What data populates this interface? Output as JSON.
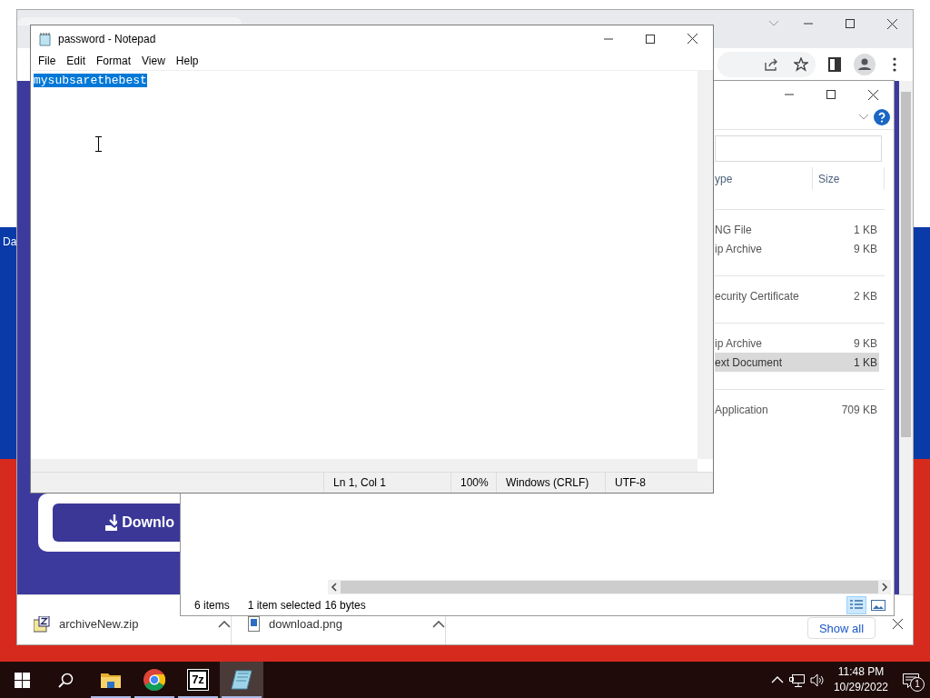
{
  "desktop": {
    "icon_label": "Da"
  },
  "browser": {
    "page": {
      "download_button": "Downlo"
    },
    "downloads": [
      {
        "name": "archiveNew.zip",
        "kind": "archive"
      },
      {
        "name": "download.png",
        "kind": "image"
      }
    ],
    "show_all": "Show all"
  },
  "explorer": {
    "columns": [
      "ype",
      "Size"
    ],
    "groups": [
      {
        "rows": [
          {
            "type": "NG File",
            "size": "1 KB",
            "selected": false
          },
          {
            "type": "ip Archive",
            "size": "9 KB",
            "selected": false
          }
        ]
      },
      {
        "rows": [
          {
            "type": "ecurity Certificate",
            "size": "2 KB",
            "selected": false
          }
        ]
      },
      {
        "rows": [
          {
            "type": "ip Archive",
            "size": "9 KB",
            "selected": false
          },
          {
            "type": "ext Document",
            "size": "1 KB",
            "selected": true
          }
        ]
      },
      {
        "rows": [
          {
            "type": "Application",
            "size": "709 KB",
            "selected": false
          }
        ]
      }
    ],
    "status": {
      "count": "6 items",
      "selection": "1 item selected",
      "size": "16 bytes"
    },
    "views": [
      {
        "kind": "details",
        "selected": true
      },
      {
        "kind": "preview",
        "selected": false
      }
    ]
  },
  "notepad": {
    "title": "password - Notepad",
    "menu": [
      "File",
      "Edit",
      "Format",
      "View",
      "Help"
    ],
    "text": "mysubsarethebest",
    "text_selected": true,
    "status_bar": [
      "Ln 1, Col 1",
      "100%",
      "Windows (CRLF)",
      "UTF-8"
    ]
  },
  "taskbar": {
    "apps": [
      {
        "kind": "explorer",
        "running": true,
        "selected": false
      },
      {
        "kind": "browser",
        "running": true,
        "selected": false
      },
      {
        "kind": "archiver",
        "label": "7z",
        "running": true,
        "selected": false
      },
      {
        "kind": "notepad",
        "running": true,
        "selected": true
      }
    ],
    "time": "11:48 PM",
    "date": "10/29/2022",
    "notification_count": "1"
  }
}
